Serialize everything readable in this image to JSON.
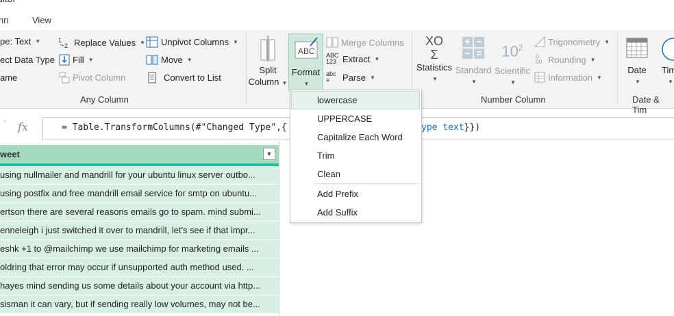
{
  "window": {
    "title_fragment": "ditor"
  },
  "tabs": [
    {
      "label": "nn"
    },
    {
      "label": "View"
    }
  ],
  "ribbon": {
    "any_column": {
      "data_type": "pe: Text",
      "detect_data_type": "ect Data Type",
      "rename": "ame",
      "replace_values": "Replace Values",
      "fill": "Fill",
      "pivot_column": "Pivot Column",
      "unpivot_columns": "Unpivot Columns",
      "move": "Move",
      "convert_to_list": "Convert to List",
      "group_label": "Any Column"
    },
    "text_column": {
      "split_column_l1": "Split",
      "split_column_l2": "Column",
      "format_label": "Format",
      "merge_columns": "Merge Columns",
      "extract": "Extract",
      "parse": "Parse",
      "extract_icon_text_top": "ABC",
      "extract_icon_text_bottom": "123",
      "parse_icon_text": "abc"
    },
    "number_column": {
      "statistics": "Statistics",
      "standard": "Standard",
      "scientific": "Scientific",
      "scientific_icon_text": "10",
      "scientific_icon_sup": "2",
      "statistics_icon_text": "XO",
      "trigonometry": "Trigonometry",
      "rounding": "Rounding",
      "information": "Information",
      "group_label": "Number Column"
    },
    "date_time": {
      "date": "Date",
      "time": "Tim",
      "group_label": "Date & Tim"
    }
  },
  "formula_bar": {
    "fx": "fx",
    "formula_part1": "= Table.TransformColumns(#\"Changed Type\",{",
    "formula_kw": "ype text",
    "formula_end": "}})"
  },
  "table": {
    "column_header": "weet",
    "rows": [
      "using nullmailer and mandrill for your ubuntu linux server outbo...",
      "using postfix and free mandrill email service for smtp on ubuntu...",
      "ertson there are several reasons emails go to spam. mind submi...",
      "enneleigh i just switched it over to mandrill, let's see if that impr...",
      "eshk +1 to @mailchimp we use mailchimp for marketing emails ...",
      "oldring that error may occur if unsupported auth method used. ...",
      "hayes mind sending us some details about your account via http...",
      "sisman it can vary, but if sending really low volumes, may not be..."
    ]
  },
  "format_menu": {
    "items": [
      {
        "label": "lowercase",
        "highlighted": true
      },
      {
        "label": "UPPERCASE"
      },
      {
        "label": "Capitalize Each Word"
      },
      {
        "label": "Trim"
      },
      {
        "label": "Clean"
      },
      {
        "label": "Add Prefix"
      },
      {
        "label": "Add Suffix"
      }
    ]
  },
  "colors": {
    "ribbon_bg": "#f3f3f3",
    "header_green": "#a3d9bf",
    "row_green": "#d8efe3",
    "accent_teal": "#2fb89a",
    "icon_blue": "#2e6fa7",
    "disabled_gray": "#9a9a9a"
  }
}
